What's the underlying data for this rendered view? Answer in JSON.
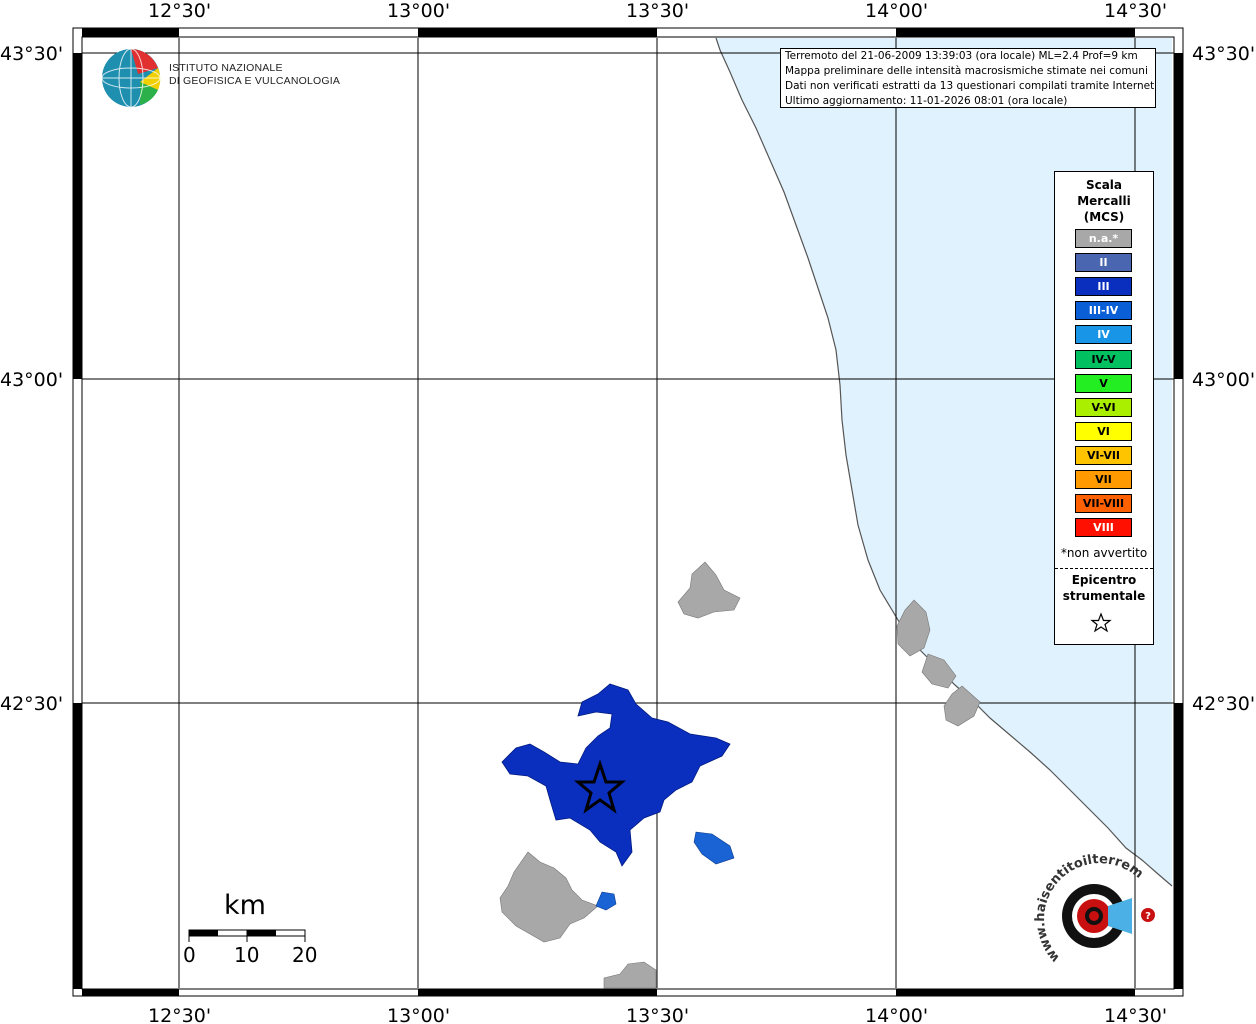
{
  "map": {
    "lat_labels": [
      "43°30'",
      "43°00'",
      "42°30'"
    ],
    "lon_labels": [
      "12°30'",
      "13°00'",
      "13°30'",
      "14°00'",
      "14°30'"
    ]
  },
  "logo": {
    "line1": "ISTITUTO NAZIONALE",
    "line2": "DI GEOFISICA E VULCANOLOGIA"
  },
  "info": {
    "line1": "Terremoto del 21-06-2009 13:39:03 (ora locale) ML=2.4 Prof=9 km",
    "line2": "Mappa preliminare delle intensità macrosismiche stimate nei comuni",
    "line3": "Dati non verificati estratti da 13 questionari compilati tramite Internet.",
    "line4": "Ultimo aggiornamento: 11-01-2026 08:01 (ora locale)"
  },
  "legend": {
    "title_line1": "Scala",
    "title_line2": "Mercalli",
    "title_line3": "(MCS)",
    "items": [
      {
        "label": "n.a.*",
        "color": "#a8a8a8",
        "text_color": "#ffffff"
      },
      {
        "label": "II",
        "color": "#4a66b0",
        "text_color": "#ffffff"
      },
      {
        "label": "III",
        "color": "#0a2fbf",
        "text_color": "#ffffff"
      },
      {
        "label": "III-IV",
        "color": "#0a5fd6",
        "text_color": "#ffffff"
      },
      {
        "label": "IV",
        "color": "#1895e6",
        "text_color": "#ffffff"
      },
      {
        "label": "IV-V",
        "color": "#00c060",
        "text_color": "#000000"
      },
      {
        "label": "V",
        "color": "#22ee22",
        "text_color": "#000000"
      },
      {
        "label": "V-VI",
        "color": "#aaee00",
        "text_color": "#000000"
      },
      {
        "label": "VI",
        "color": "#ffff00",
        "text_color": "#000000"
      },
      {
        "label": "VI-VII",
        "color": "#ffc400",
        "text_color": "#000000"
      },
      {
        "label": "VII",
        "color": "#ff9a00",
        "text_color": "#000000"
      },
      {
        "label": "VII-VIII",
        "color": "#ff6000",
        "text_color": "#000000"
      },
      {
        "label": "VIII",
        "color": "#ff1000",
        "text_color": "#ffffff"
      }
    ],
    "note": "*non avvertito",
    "epicenter_line1": "Epicentro",
    "epicenter_line2": "strumentale"
  },
  "scale_bar": {
    "title": "km",
    "labels": [
      "0",
      "10",
      "20"
    ]
  },
  "colors": {
    "sea": "#e0f2fd",
    "intensity_III": "#0a2fbf",
    "intensity_III_IV": "#1a63d4",
    "not_felt": "#a8a8a8",
    "coast": "#555555"
  },
  "brand": {
    "text": "www.haisentitoilterremoto.it"
  }
}
